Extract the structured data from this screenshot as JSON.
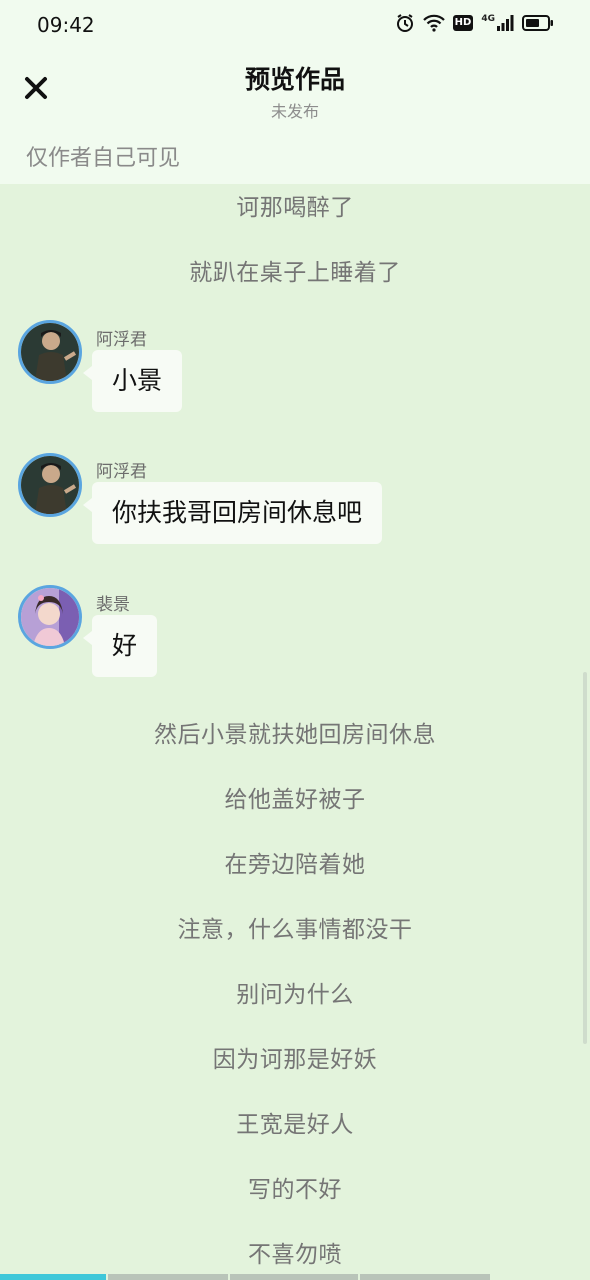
{
  "status_bar": {
    "time": "09:42",
    "icons": [
      "alarm-icon",
      "wifi-icon",
      "hd-icon",
      "cellular-4g-icon",
      "battery-icon"
    ],
    "hd_label": "HD",
    "network_label": "4G"
  },
  "header": {
    "title": "预览作品",
    "subtitle": "未发布",
    "visibility_note": "仅作者自己可见",
    "close_icon": "close-icon"
  },
  "story": {
    "narration_top": [
      "诃那喝醉了",
      "就趴在桌子上睡着了"
    ],
    "messages": [
      {
        "speaker": "阿浮君",
        "text": "小景",
        "avatar": "avatar-afujun"
      },
      {
        "speaker": "阿浮君",
        "text": "你扶我哥回房间休息吧",
        "avatar": "avatar-afujun"
      },
      {
        "speaker": "裴景",
        "text": "好",
        "avatar": "avatar-peijing"
      }
    ],
    "narration_bottom": [
      "然后小景就扶她回房间休息",
      "给他盖好被子",
      "在旁边陪着她",
      "注意，什么事情都没干",
      "别问为什么",
      "因为诃那是好妖",
      "王宽是好人",
      "写的不好",
      "不喜勿喷"
    ]
  },
  "colors": {
    "background": "#e3f3dc",
    "header_background": "#f1fbef",
    "bubble": "#f7fbf5",
    "avatar_ring": "#5aa5e0",
    "progress_active": "#3fc7d9",
    "progress_inactive": "#b9c4b9"
  },
  "reading_progress": {
    "segments": 4,
    "active_segment": 1
  }
}
